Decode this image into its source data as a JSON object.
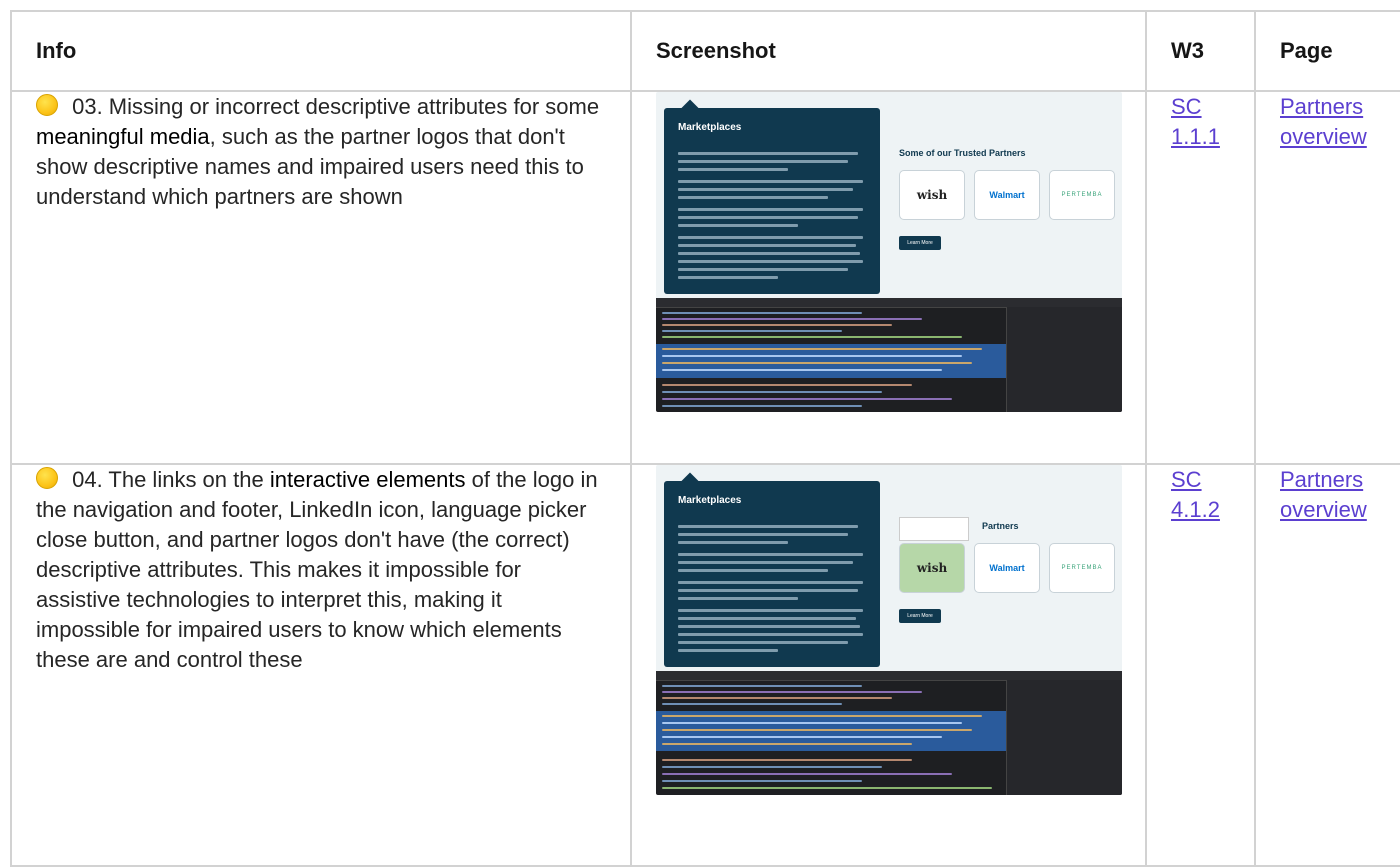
{
  "table": {
    "headers": {
      "info": "Info",
      "screenshot": "Screenshot",
      "w3": "W3",
      "page": "Page"
    },
    "rows": [
      {
        "severity_color": "#fcc419",
        "info_prefix": " 03. Missing or incorrect descriptive attributes for some ",
        "info_bold": "meaningful media",
        "info_suffix": ", such as the partner logos that don't show descriptive names and impaired users need this to understand which partners are shown",
        "w3_link": "SC 1.1.1",
        "page_link": "Partners overview",
        "screenshot": {
          "panel_title": "Marketplaces",
          "partners_heading": "Some of our Trusted Partners",
          "logos": [
            "wish",
            "Walmart",
            "PERTEMBA"
          ],
          "button": "Learn More"
        }
      },
      {
        "severity_color": "#fcc419",
        "info_prefix": " 04. The links on the ",
        "info_bold": "interactive elements",
        "info_suffix": " of the logo in the navigation and footer, LinkedIn icon, language picker close button, and partner logos don't have (the correct) descriptive attributes. This makes it impossible for assistive technologies to interpret this, making it impossible for impaired users to know which elements these are and control these",
        "w3_link": "SC 4.1.2",
        "page_link": "Partners overview",
        "screenshot": {
          "panel_title": "Marketplaces",
          "partners_heading": "Partners",
          "logos": [
            "wish",
            "Walmart",
            "PERTEMBA"
          ],
          "button": "Learn More"
        }
      }
    ]
  }
}
